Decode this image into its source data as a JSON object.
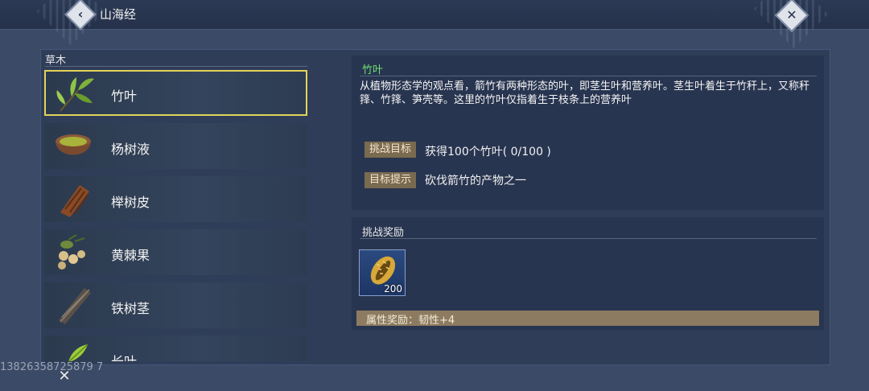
{
  "header": {
    "title": "山海经",
    "back_icon": "‹",
    "close_icon": "✕"
  },
  "category": {
    "label": "草木",
    "items": [
      {
        "label": "竹叶",
        "icon": "bamboo-leaf-icon",
        "selected": true
      },
      {
        "label": "杨树液",
        "icon": "bowl-icon",
        "selected": false
      },
      {
        "label": "榉树皮",
        "icon": "bark-icon",
        "selected": false
      },
      {
        "label": "黄棘果",
        "icon": "fruit-icon",
        "selected": false
      },
      {
        "label": "铁树茎",
        "icon": "stem-icon",
        "selected": false
      },
      {
        "label": "长叶",
        "icon": "leaf-icon",
        "selected": false
      }
    ]
  },
  "detail": {
    "name": "竹叶",
    "description": "从植物形态学的观点看，箭竹有两种形态的叶，即茎生叶和营养叶。茎生叶着生于竹秆上，又称秆箨、竹箨、笋壳等。这里的竹叶仅指着生于枝条上的营养叶",
    "goal_tag": "挑战目标",
    "goal_text": "获得100个竹叶( 0/100 )",
    "hint_tag": "目标提示",
    "hint_text": "砍伐箭竹的产物之一"
  },
  "reward": {
    "title": "挑战奖励",
    "item_icon": "golden-cowrie-shell-icon",
    "count": "200",
    "attribute": "属性奖励：韧性+4"
  },
  "footer": {
    "watermark": "13826358725879 7",
    "icon": "✕"
  },
  "colors": {
    "background": "#3b4a66",
    "selected_border": "#e2d45a",
    "item_name_green": "#6fe06f",
    "tag_bg": "#7a6a50",
    "attr_bar": "#8c7b60"
  }
}
